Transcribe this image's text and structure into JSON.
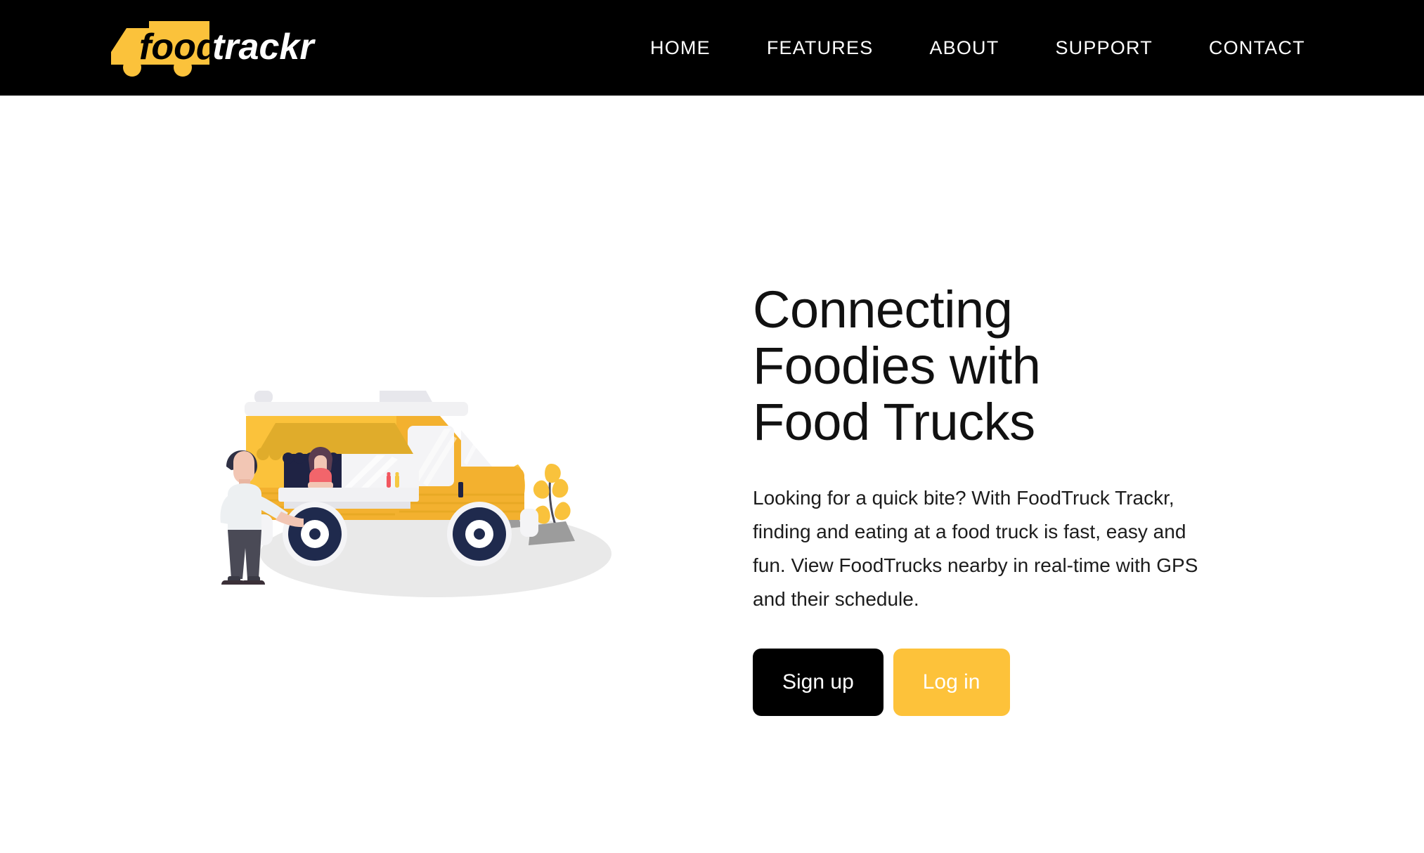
{
  "brand": {
    "logo_food": "food",
    "logo_trackr": "trackr",
    "accent_color": "#FDC23A",
    "dark_color": "#000000"
  },
  "nav": {
    "items": [
      {
        "label": "HOME"
      },
      {
        "label": "FEATURES"
      },
      {
        "label": "ABOUT"
      },
      {
        "label": "SUPPORT"
      },
      {
        "label": "CONTACT"
      }
    ]
  },
  "hero": {
    "title": "Connecting\nFoodies with\nFood Trucks",
    "subtitle": "Looking for a quick bite? With FoodTruck Trackr, finding and eating at a food truck is fast, easy and fun. View FoodTrucks nearby in real-time with GPS and their schedule.",
    "primary_button": "Sign up",
    "secondary_button": "Log in",
    "illustration_name": "food-truck-illustration"
  },
  "palette": {
    "truck_body": "#FBC23B",
    "truck_body_shade": "#E8A924",
    "truck_roof": "#F1F1F3",
    "awning": "#E0AC2B",
    "window_glass": "#F4F4F6",
    "window_dark": "#1F2344",
    "tire": "#1F2A4D",
    "ground": "#E9E9E9",
    "rock": "#9C9C9C",
    "skin": "#F2C6B4",
    "hair_dark": "#2F3044",
    "shirt_light": "#EDF0F2",
    "pants": "#4A4A56",
    "vendor_shirt": "#F2656B",
    "leaf": "#F9C23C",
    "ketchup": "#F2575F",
    "mustard": "#F5C842"
  }
}
